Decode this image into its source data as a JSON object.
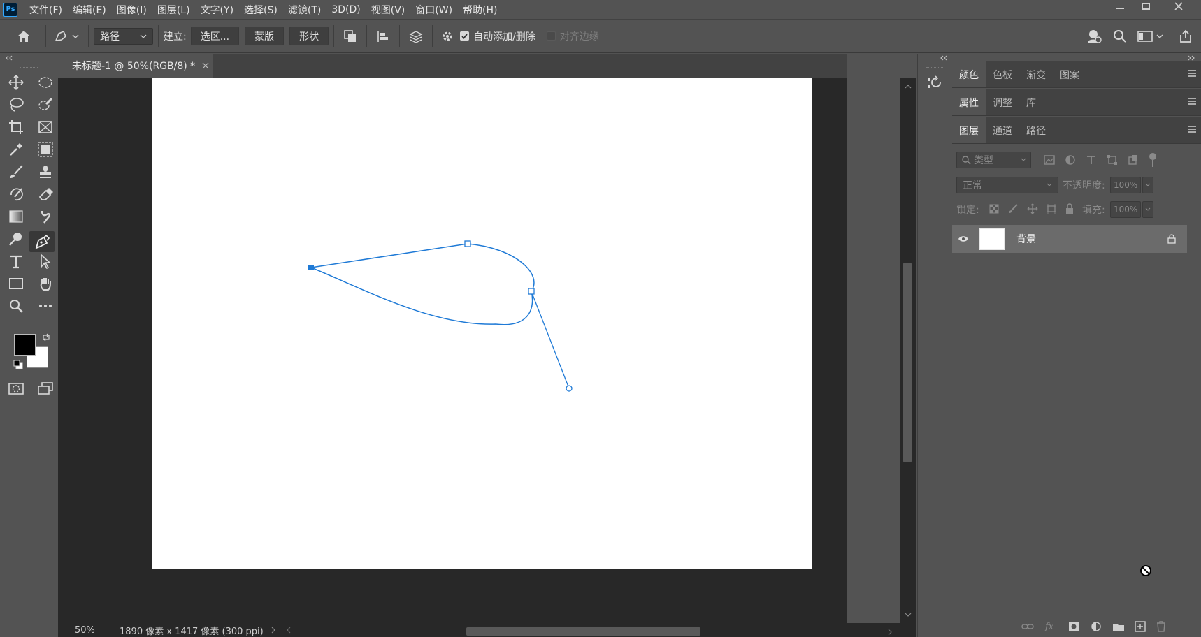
{
  "app": {
    "logo_text": "Ps",
    "menu": [
      "文件(F)",
      "编辑(E)",
      "图像(I)",
      "图层(L)",
      "文字(Y)",
      "选择(S)",
      "滤镜(T)",
      "3D(D)",
      "视图(V)",
      "窗口(W)",
      "帮助(H)"
    ]
  },
  "options_bar": {
    "mode_select": "路径",
    "make_label": "建立:",
    "selection_button": "选区...",
    "mask_button": "蒙版",
    "shape_button": "形状",
    "auto_add_delete_label": "自动添加/删除",
    "auto_add_delete_checked": true,
    "align_edges_label": "对齐边缘",
    "align_edges_checked": false
  },
  "document": {
    "tab_title": "未标题-1 @ 50%(RGB/8) *",
    "zoom": "50%",
    "doc_info": "1890 像素 x 1417 像素 (300 ppi)"
  },
  "colors": {
    "foreground": "#000000",
    "background": "#ffffff",
    "path_stroke": "#1f7ad6",
    "ui_bg": "#535353"
  },
  "panels": {
    "group1_tabs": [
      "颜色",
      "色板",
      "渐变",
      "图案"
    ],
    "group2_tabs": [
      "属性",
      "调整",
      "库"
    ],
    "group3_tabs": [
      "图层",
      "通道",
      "路径"
    ],
    "layer_filter_placeholder": "类型",
    "blend_mode": "正常",
    "opacity_label": "不透明度:",
    "opacity_value": "100%",
    "lock_label": "锁定:",
    "fill_label": "填充:",
    "fill_value": "100%",
    "layers": [
      {
        "name": "背景",
        "visible": true,
        "locked": true
      }
    ]
  }
}
